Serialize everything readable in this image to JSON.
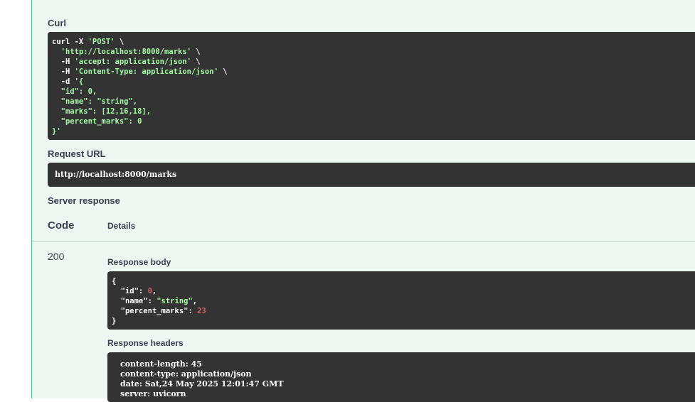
{
  "curl": {
    "label": "Curl",
    "lines": [
      {
        "segments": [
          {
            "t": "curl -X ",
            "c": "kw"
          },
          {
            "t": "'POST'",
            "c": "str"
          },
          {
            "t": " \\",
            "c": "kw"
          }
        ]
      },
      {
        "segments": [
          {
            "t": "  ",
            "c": "kw"
          },
          {
            "t": "'http://localhost:8000/marks'",
            "c": "str"
          },
          {
            "t": " \\",
            "c": "kw"
          }
        ]
      },
      {
        "segments": [
          {
            "t": "  -H ",
            "c": "kw"
          },
          {
            "t": "'accept: application/json'",
            "c": "str"
          },
          {
            "t": " \\",
            "c": "kw"
          }
        ]
      },
      {
        "segments": [
          {
            "t": "  -H ",
            "c": "kw"
          },
          {
            "t": "'Content-Type: application/json'",
            "c": "str"
          },
          {
            "t": " \\",
            "c": "kw"
          }
        ]
      },
      {
        "segments": [
          {
            "t": "  -d ",
            "c": "kw"
          },
          {
            "t": "'{",
            "c": "str"
          }
        ]
      },
      {
        "segments": [
          {
            "t": "  \"id\": 0,",
            "c": "str"
          }
        ]
      },
      {
        "segments": [
          {
            "t": "  \"name\": \"string\",",
            "c": "str"
          }
        ]
      },
      {
        "segments": [
          {
            "t": "  \"marks\": [12,16,18],",
            "c": "str"
          }
        ]
      },
      {
        "segments": [
          {
            "t": "  \"percent_marks\": 0",
            "c": "str"
          }
        ]
      },
      {
        "segments": [
          {
            "t": "}'",
            "c": "str"
          }
        ]
      }
    ]
  },
  "request_url": {
    "label": "Request URL",
    "value": "http://localhost:8000/marks"
  },
  "server_response": {
    "label": "Server response",
    "code_header": "Code",
    "details_header": "Details",
    "status_code": "200",
    "response_body_label": "Response body",
    "response_body_lines": [
      {
        "segments": [
          {
            "t": "{",
            "c": "kw"
          }
        ]
      },
      {
        "segments": [
          {
            "t": "  \"id\": ",
            "c": "kw"
          },
          {
            "t": "0",
            "c": "num"
          },
          {
            "t": ",",
            "c": "kw"
          }
        ]
      },
      {
        "segments": [
          {
            "t": "  \"name\": ",
            "c": "kw"
          },
          {
            "t": "\"string\"",
            "c": "str"
          },
          {
            "t": ",",
            "c": "kw"
          }
        ]
      },
      {
        "segments": [
          {
            "t": "  \"percent_marks\": ",
            "c": "kw"
          },
          {
            "t": "23",
            "c": "num"
          }
        ]
      },
      {
        "segments": [
          {
            "t": "}",
            "c": "kw"
          }
        ]
      }
    ],
    "response_headers_label": "Response headers",
    "response_headers_lines": [
      "content-length: 45",
      "content-type: application/json",
      "date: Sat,24 May 2025 12:01:47 GMT",
      "server: uvicorn"
    ]
  }
}
